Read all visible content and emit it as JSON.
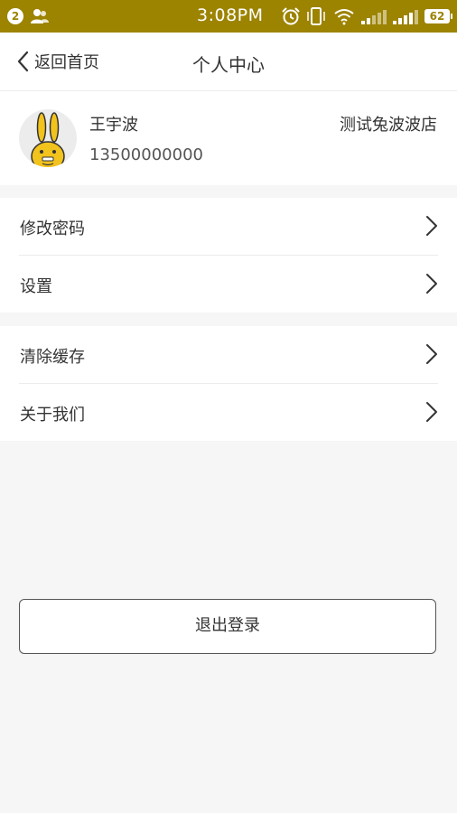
{
  "status_bar": {
    "notification_count": "2",
    "time": "3:08PM",
    "battery": "62",
    "icons": [
      "notification-badge",
      "users-icon",
      "alarm-icon",
      "vibrate-icon",
      "wifi-icon",
      "signal-icon",
      "signal-icon",
      "battery-icon"
    ]
  },
  "nav": {
    "back_label": "返回首页",
    "title": "个人中心"
  },
  "profile": {
    "name": "王宇波",
    "phone": "13500000000",
    "store": "测试兔波波店"
  },
  "menu": {
    "group1": [
      {
        "label": "修改密码"
      },
      {
        "label": "设置"
      }
    ],
    "group2": [
      {
        "label": "清除缓存"
      },
      {
        "label": "关于我们"
      }
    ]
  },
  "logout_label": "退出登录",
  "colors": {
    "status_bar": "#9c8300",
    "background": "#f6f6f6",
    "avatar_yellow": "#f2c21d"
  }
}
